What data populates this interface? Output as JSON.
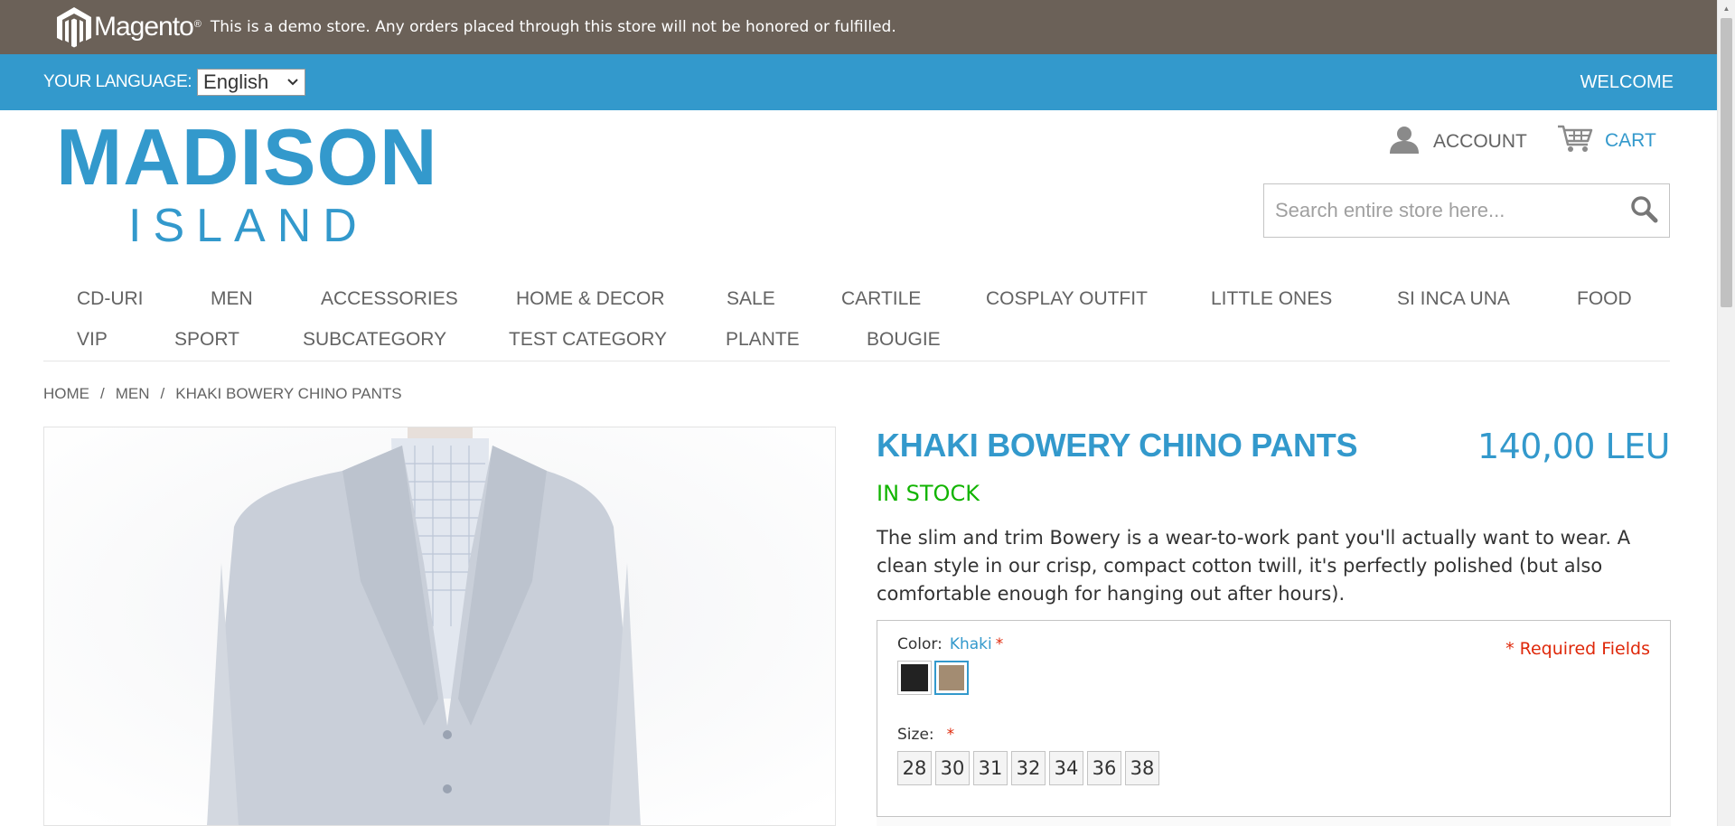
{
  "demo_bar": {
    "brand": "Magento",
    "brand_mark": "®",
    "notice": "This is a demo store. Any orders placed through this store will not be honored or fulfilled."
  },
  "lang_bar": {
    "label": "YOUR LANGUAGE:",
    "selected": "English",
    "welcome": "WELCOME"
  },
  "logo": {
    "line1": "MADISON",
    "line2": "ISLAND"
  },
  "header": {
    "account_label": "ACCOUNT",
    "cart_label": "CART",
    "search_placeholder": "Search entire store here...",
    "icons": {
      "account": "user-icon",
      "cart": "cart-icon",
      "search": "search-icon"
    }
  },
  "nav": {
    "items": [
      "CD-URI",
      "MEN",
      "ACCESSORIES",
      "HOME & DECOR",
      "SALE",
      "CARTILE",
      "COSPLAY OUTFIT",
      "LITTLE ONES",
      "SI INCA UNA",
      "FOOD",
      "VIP",
      "SPORT",
      "SUBCATEGORY",
      "TEST CATEGORY",
      "PLANTE",
      "BOUGIE"
    ]
  },
  "breadcrumb": {
    "items": [
      "HOME",
      "MEN",
      "KHAKI BOWERY CHINO PANTS"
    ],
    "separator": "/"
  },
  "product": {
    "name": "KHAKI BOWERY CHINO PANTS",
    "price": "140,00 LEU",
    "stock": "IN STOCK",
    "description": "The slim and trim Bowery is a wear-to-work pant you'll actually want to wear. A clean style in our crisp, compact cotton twill, it's perfectly polished (but also comfortable enough for hanging out after hours)."
  },
  "options": {
    "required_fields": "* Required Fields",
    "color_label": "Color:",
    "color_value": "Khaki",
    "size_label": "Size:",
    "required_mark": "*",
    "colors": [
      {
        "name": "Charcoal",
        "hex": "#222222"
      },
      {
        "name": "Khaki",
        "hex": "#a38c72"
      }
    ],
    "sizes": [
      "28",
      "30",
      "31",
      "32",
      "34",
      "36",
      "38"
    ]
  },
  "colors": {
    "demo_bar": "#6b6158",
    "accent": "#3399cc",
    "in_stock": "#11b400",
    "required": "#df280a"
  }
}
